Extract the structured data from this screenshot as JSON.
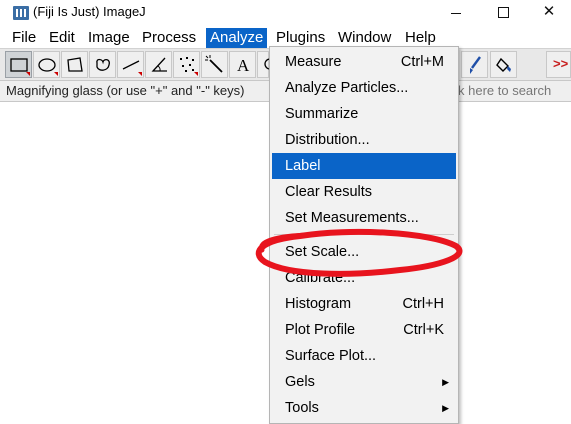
{
  "window": {
    "title": "(Fiji Is Just) ImageJ",
    "buttons": {
      "minimize": "—",
      "maximize": "",
      "close": "✕"
    }
  },
  "menubar": {
    "items": [
      "File",
      "Edit",
      "Image",
      "Process",
      "Analyze",
      "Plugins",
      "Window",
      "Help"
    ],
    "active": "Analyze"
  },
  "toolbar": {
    "tools": [
      "rectangle-tool",
      "oval-tool",
      "polygon-tool",
      "freehand-tool",
      "line-tool",
      "angle-tool",
      "multipoint-tool",
      "wand-tool",
      "text-tool",
      "zoom-tool"
    ],
    "right_tools": [
      "brush-tool",
      "flood-fill-tool",
      "more-tools"
    ],
    "more_label": ">>",
    "text_tool_label": "A",
    "selected": "rectangle-tool"
  },
  "statusbar": {
    "text": "Magnifying glass (or use \"+\" and \"-\" keys)",
    "search_hint": "k here to search"
  },
  "dropdown": {
    "items": [
      {
        "label": "Measure",
        "shortcut": "Ctrl+M"
      },
      {
        "label": "Analyze Particles...",
        "shortcut": ""
      },
      {
        "label": "Summarize",
        "shortcut": ""
      },
      {
        "label": "Distribution...",
        "shortcut": ""
      },
      {
        "label": "Label",
        "shortcut": "",
        "highlighted": true
      },
      {
        "label": "Clear Results",
        "shortcut": ""
      },
      {
        "label": "Set Measurements...",
        "shortcut": ""
      },
      {
        "label": "Set Scale...",
        "shortcut": "",
        "annotated": true
      },
      {
        "label": "Calibrate...",
        "shortcut": ""
      },
      {
        "label": "Histogram",
        "shortcut": "Ctrl+H"
      },
      {
        "label": "Plot Profile",
        "shortcut": "Ctrl+K"
      },
      {
        "label": "Surface Plot...",
        "shortcut": ""
      },
      {
        "label": "Gels",
        "shortcut": "",
        "submenu": true
      },
      {
        "label": "Tools",
        "shortcut": "",
        "submenu": true
      }
    ],
    "submenu_arrow": "▶"
  },
  "colors": {
    "highlight": "#0a64c8",
    "annotation": "#e8141e",
    "toolbar_bg": "#e8e8e8",
    "menu_bg": "#f2f2f2"
  }
}
